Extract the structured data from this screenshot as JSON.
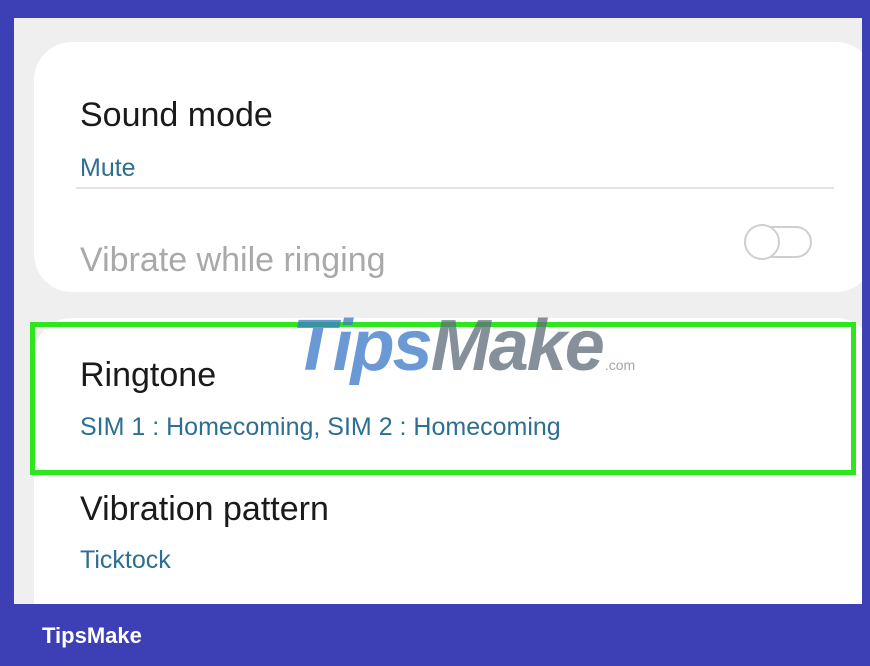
{
  "settings": {
    "sound_mode": {
      "title": "Sound mode",
      "value": "Mute"
    },
    "vibrate_while_ringing": {
      "title": "Vibrate while ringing",
      "enabled": false
    },
    "ringtone": {
      "title": "Ringtone",
      "value": "SIM 1 : Homecoming, SIM 2 : Homecoming"
    },
    "vibration_pattern": {
      "title": "Vibration pattern",
      "value": "Ticktock"
    }
  },
  "watermark": {
    "tips": "Tips",
    "make": "Make",
    "com": ".com"
  },
  "footer": {
    "brand": "TipsMake"
  },
  "colors": {
    "frame": "#3d3fb5",
    "highlight": "#2ee61e",
    "accent_text": "#2d6e93",
    "screen_bg": "#efefef",
    "card_bg": "#ffffff"
  },
  "icons": {
    "toggle": "toggle-switch-off-icon"
  }
}
